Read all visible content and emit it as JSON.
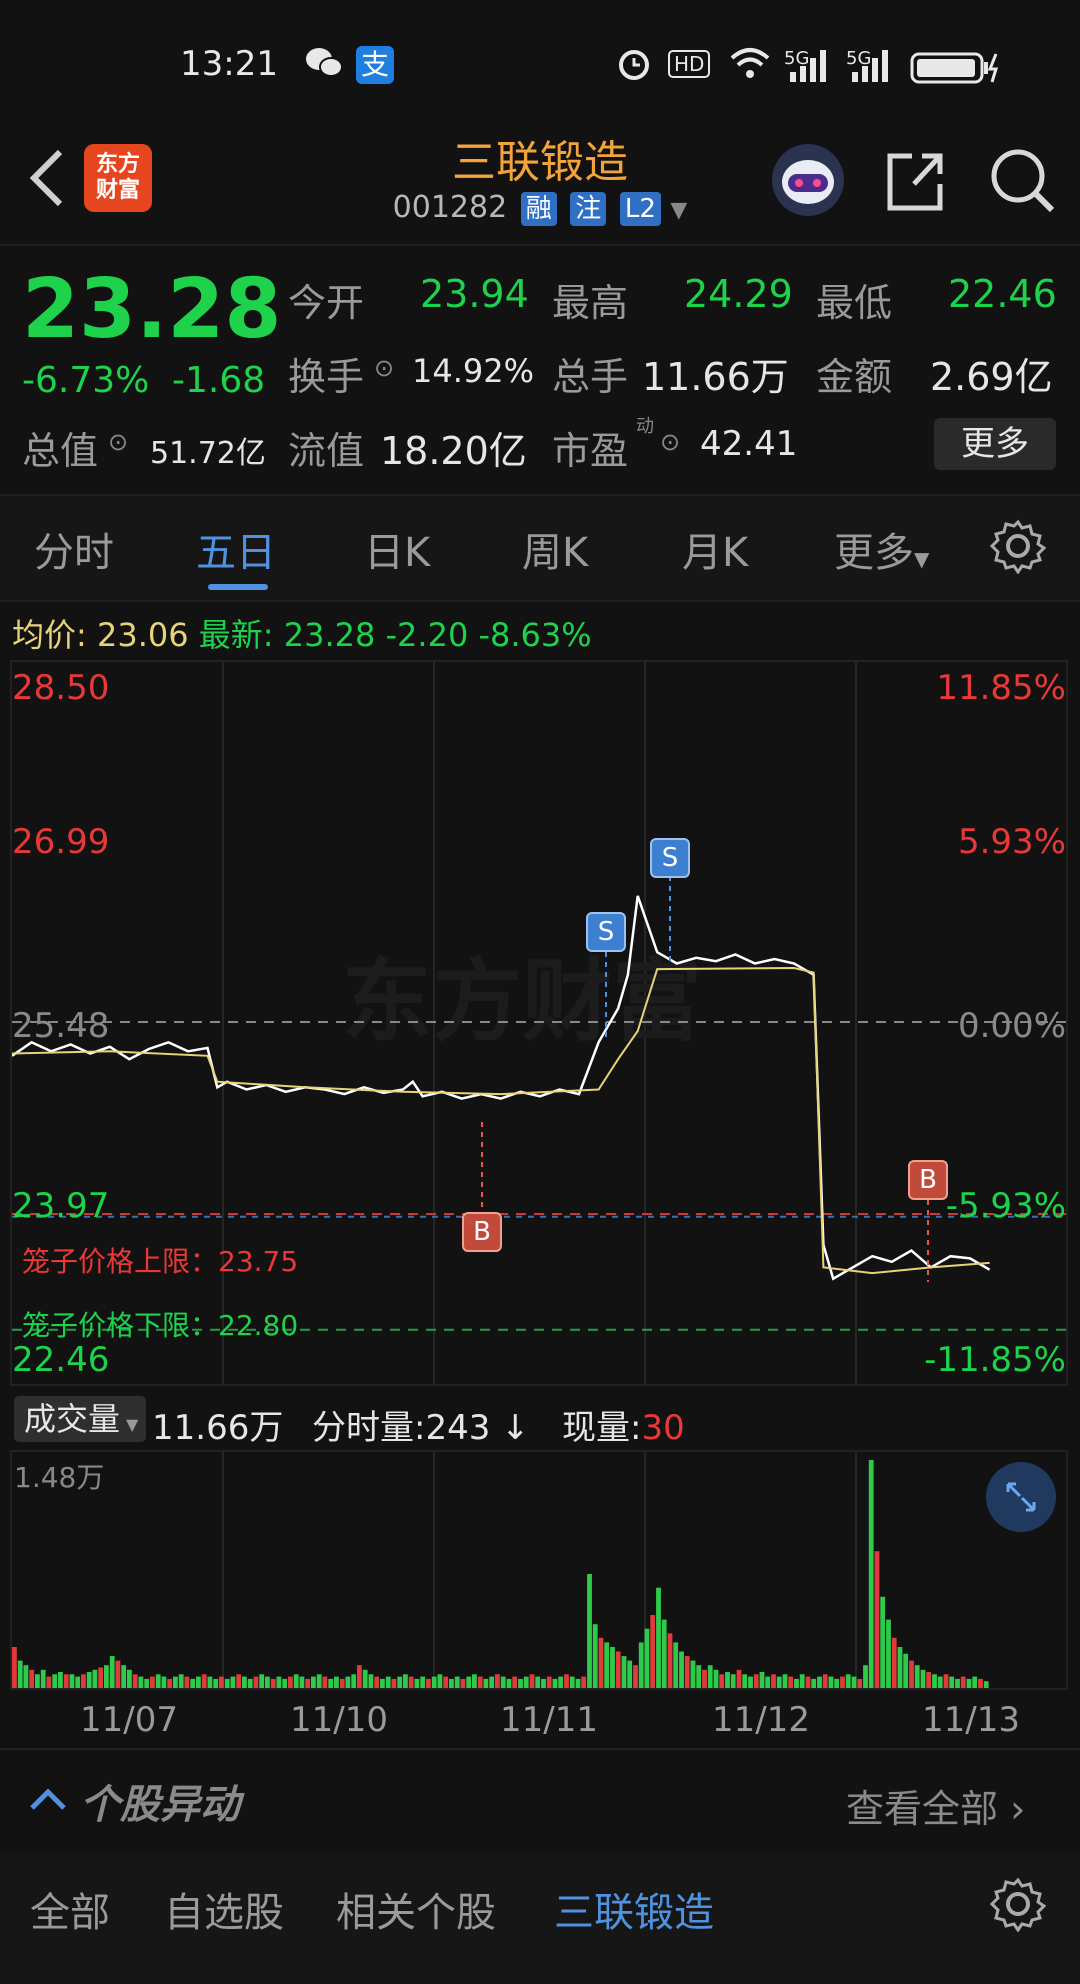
{
  "status_bar": {
    "time": "13:21",
    "wechat_icon": "wechat-icon",
    "alipay_label": "支",
    "hd_label": "HD",
    "net1": "5G",
    "net2": "5G"
  },
  "header": {
    "logo_line1": "东方",
    "logo_line2": "财富",
    "title": "三联锻造",
    "code": "001282",
    "tags": [
      "融",
      "注",
      "L2"
    ]
  },
  "quote": {
    "price": "23.28",
    "change_pct": "-6.73%",
    "change": "-1.68",
    "open_label": "今开",
    "open": "23.94",
    "high_label": "最高",
    "high": "24.29",
    "low_label": "最低",
    "low": "22.46",
    "turnover_label": "换手",
    "turnover": "14.92%",
    "volume_label": "总手",
    "volume": "11.66万",
    "amount_label": "金额",
    "amount": "2.69亿",
    "mktcap_label": "总值",
    "mktcap": "51.72亿",
    "float_label": "流值",
    "float": "18.20亿",
    "pe_label": "市盈",
    "pe_sup": "动",
    "pe": "42.41",
    "more_button": "更多"
  },
  "tabs": [
    "分时",
    "五日",
    "日K",
    "周K",
    "月K",
    "更多"
  ],
  "info_line": {
    "avg_label": "均价:",
    "avg": "23.06",
    "latest_label": "最新:",
    "latest": "23.28",
    "diff": "-2.20",
    "diff_pct": "-8.63%"
  },
  "chart_data": {
    "type": "line",
    "price_labels_left": [
      "28.50",
      "26.99",
      "25.48",
      "23.97",
      "22.46"
    ],
    "pct_labels_right": [
      "11.85%",
      "5.93%",
      "0.00%",
      "-5.93%",
      "-11.85%"
    ],
    "cage_upper": "笼子价格上限：23.75",
    "cage_lower": "笼子价格下限：22.80",
    "markers": [
      "S",
      "S",
      "B",
      "B"
    ],
    "dates": [
      "11/07",
      "11/10",
      "11/11",
      "11/12",
      "11/13"
    ],
    "prev_close": 25.48,
    "ylim": [
      22.46,
      28.5
    ],
    "series": [
      {
        "name": "price",
        "color": "#ffffff",
        "x": [
          0,
          10,
          20,
          30,
          40,
          50,
          60,
          70,
          80,
          90,
          100,
          105,
          110,
          120,
          130,
          140,
          150,
          160,
          170,
          180,
          190,
          200,
          205,
          210,
          220,
          230,
          240,
          250,
          260,
          270,
          280,
          290,
          300,
          310,
          315,
          320,
          330,
          340,
          350,
          360,
          370,
          380,
          390,
          400,
          410,
          415,
          420,
          430,
          440,
          450,
          460,
          470,
          480,
          490,
          500
        ],
        "values": [
          25.18,
          25.3,
          25.22,
          25.28,
          25.2,
          25.26,
          25.15,
          25.24,
          25.3,
          25.22,
          25.25,
          24.9,
          24.95,
          24.88,
          24.92,
          24.86,
          24.9,
          24.88,
          24.84,
          24.9,
          24.85,
          24.88,
          24.95,
          24.82,
          24.86,
          24.8,
          24.84,
          24.8,
          24.86,
          24.82,
          24.88,
          24.84,
          25.3,
          25.6,
          25.9,
          26.6,
          26.1,
          26.0,
          26.05,
          26.02,
          26.08,
          26.0,
          26.04,
          26.0,
          25.9,
          23.5,
          23.2,
          23.3,
          23.4,
          23.35,
          23.45,
          23.3,
          23.4,
          23.38,
          23.28
        ]
      },
      {
        "name": "avg",
        "color": "#e8d27a",
        "x": [
          0,
          50,
          100,
          105,
          150,
          200,
          250,
          300,
          310,
          320,
          330,
          400,
          410,
          415,
          440,
          470,
          500
        ],
        "values": [
          25.2,
          25.22,
          25.18,
          24.95,
          24.9,
          24.86,
          24.84,
          24.88,
          25.15,
          25.4,
          25.95,
          25.96,
          25.92,
          23.3,
          23.25,
          23.3,
          23.34
        ]
      }
    ]
  },
  "volume": {
    "selector_label": "成交量",
    "total": "11.66万",
    "tick_label": "分时量:243",
    "current_label": "现量:",
    "current": "30",
    "max_label": "1.48万",
    "bars": [
      0.18,
      0.12,
      0.1,
      0.08,
      0.06,
      0.08,
      0.05,
      0.06,
      0.07,
      0.06,
      0.06,
      0.05,
      0.06,
      0.07,
      0.08,
      0.09,
      0.1,
      0.14,
      0.12,
      0.1,
      0.08,
      0.06,
      0.05,
      0.04,
      0.05,
      0.06,
      0.05,
      0.04,
      0.05,
      0.06,
      0.05,
      0.04,
      0.05,
      0.06,
      0.05,
      0.04,
      0.05,
      0.04,
      0.05,
      0.06,
      0.05,
      0.04,
      0.05,
      0.06,
      0.05,
      0.04,
      0.05,
      0.04,
      0.05,
      0.06,
      0.05,
      0.04,
      0.05,
      0.06,
      0.05,
      0.04,
      0.05,
      0.04,
      0.05,
      0.06,
      0.1,
      0.08,
      0.06,
      0.05,
      0.04,
      0.05,
      0.04,
      0.05,
      0.06,
      0.05,
      0.04,
      0.05,
      0.04,
      0.05,
      0.06,
      0.05,
      0.04,
      0.05,
      0.04,
      0.05,
      0.06,
      0.05,
      0.04,
      0.05,
      0.06,
      0.05,
      0.04,
      0.05,
      0.04,
      0.05,
      0.06,
      0.05,
      0.04,
      0.05,
      0.04,
      0.05,
      0.06,
      0.05,
      0.04,
      0.05,
      0.5,
      0.28,
      0.22,
      0.2,
      0.18,
      0.16,
      0.14,
      0.12,
      0.1,
      0.2,
      0.26,
      0.32,
      0.44,
      0.3,
      0.24,
      0.2,
      0.16,
      0.14,
      0.12,
      0.1,
      0.08,
      0.1,
      0.08,
      0.06,
      0.07,
      0.06,
      0.08,
      0.06,
      0.05,
      0.06,
      0.07,
      0.05,
      0.06,
      0.05,
      0.06,
      0.05,
      0.04,
      0.06,
      0.05,
      0.04,
      0.05,
      0.06,
      0.05,
      0.04,
      0.05,
      0.06,
      0.05,
      0.04,
      0.1,
      1.0,
      0.6,
      0.4,
      0.3,
      0.22,
      0.18,
      0.15,
      0.12,
      0.1,
      0.08,
      0.07,
      0.06,
      0.05,
      0.06,
      0.05,
      0.04,
      0.05,
      0.04,
      0.05,
      0.04,
      0.03
    ]
  },
  "section": {
    "title": "个股异动",
    "view_all": "查看全部"
  },
  "bottom_tabs": [
    "全部",
    "自选股",
    "相关个股",
    "三联锻造"
  ]
}
